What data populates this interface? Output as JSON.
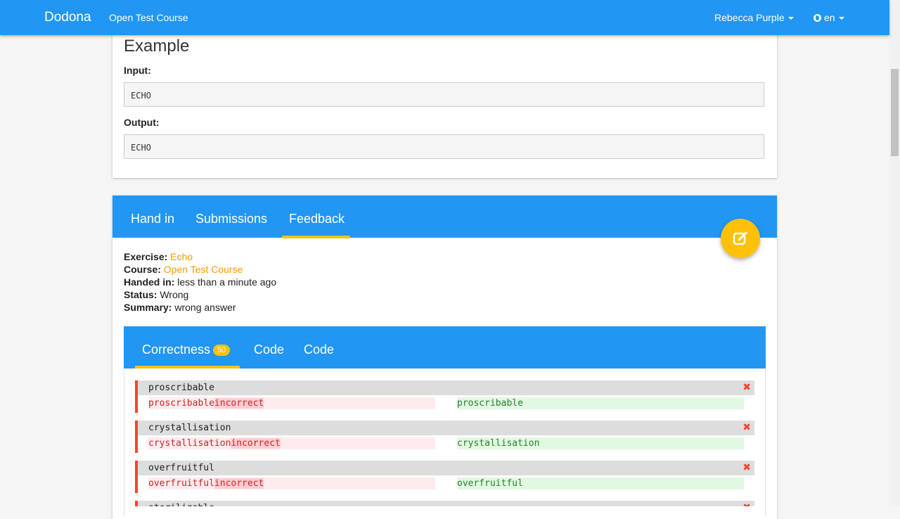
{
  "navbar": {
    "brand": "Dodona",
    "course": "Open Test Course",
    "user": "Rebecca Purple",
    "language": "en"
  },
  "example": {
    "title": "Example",
    "input_label": "Input:",
    "input_value": "ECHO",
    "output_label": "Output:",
    "output_value": "ECHO"
  },
  "feedback_tabs": {
    "hand_in": "Hand in",
    "submissions": "Submissions",
    "feedback": "Feedback"
  },
  "submission": {
    "exercise_label": "Exercise:",
    "exercise_value": "Echo",
    "course_label": "Course:",
    "course_value": "Open Test Course",
    "handed_in_label": "Handed in:",
    "handed_in_value": "less than a minute ago",
    "status_label": "Status:",
    "status_value": "Wrong",
    "summary_label": "Summary:",
    "summary_value": "wrong answer"
  },
  "result_tabs": {
    "correctness": "Correctness",
    "correctness_badge": "50",
    "code_1": "Code",
    "code_2": "Code"
  },
  "testcases": [
    {
      "input": "proscribable",
      "got": "proscribable",
      "got_extra": "incorrect",
      "expected": "proscribable"
    },
    {
      "input": "crystallisation",
      "got": "crystallisation",
      "got_extra": "incorrect",
      "expected": "crystallisation"
    },
    {
      "input": "overfruitful",
      "got": "overfruitful",
      "got_extra": "incorrect",
      "expected": "overfruitful"
    },
    {
      "input": "sterilizable"
    }
  ],
  "colors": {
    "primary": "#2196f3",
    "accent": "#ffc107",
    "link": "#ff9800",
    "error": "#f44336"
  }
}
